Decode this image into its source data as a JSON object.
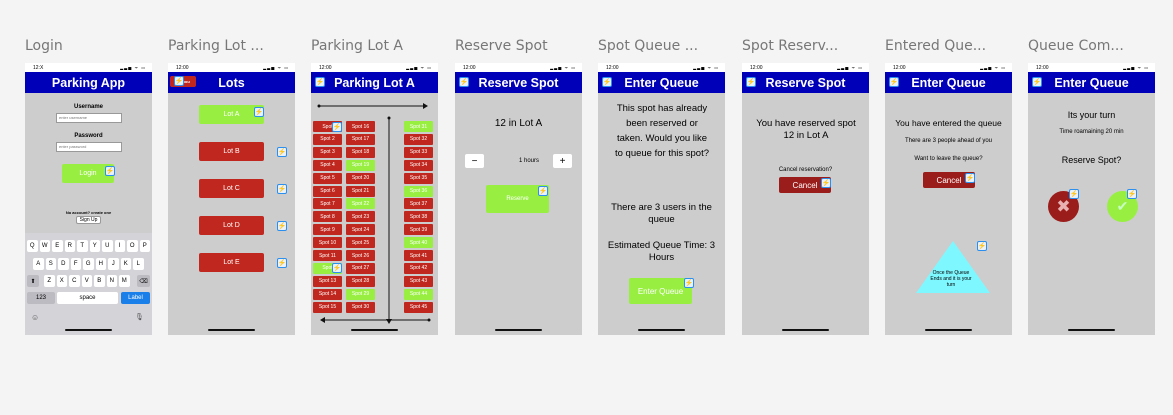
{
  "frames": [
    {
      "title": "Login"
    },
    {
      "title": "Parking Lot ..."
    },
    {
      "title": "Parking Lot A"
    },
    {
      "title": "Reserve Spot"
    },
    {
      "title": "Spot Queue ..."
    },
    {
      "title": "Spot Reserv..."
    },
    {
      "title": "Entered Que..."
    },
    {
      "title": "Queue Com..."
    }
  ],
  "status": {
    "time": "12:00",
    "time_login": "12:X",
    "signal": "▂▃▅ ᯤ ▭"
  },
  "icons": {
    "prototype": "lightning-icon"
  },
  "login": {
    "header": "Parking App",
    "username_label": "Username",
    "username_placeholder": "enter username",
    "password_label": "Password",
    "password_placeholder": "enter password",
    "login_button": "Login",
    "no_account": "No account? create one",
    "signup_button": "Sign Up",
    "keyboard": {
      "row1": [
        "Q",
        "W",
        "E",
        "R",
        "T",
        "Y",
        "U",
        "I",
        "O",
        "P"
      ],
      "row2": [
        "A",
        "S",
        "D",
        "F",
        "G",
        "H",
        "J",
        "K",
        "L"
      ],
      "row3": [
        "Z",
        "X",
        "C",
        "V",
        "B",
        "N",
        "M"
      ],
      "shift": "⬆",
      "backspace": "⌫",
      "num": "123",
      "space": "space",
      "enter": "Label",
      "emoji": "☺",
      "mic": "🎙"
    }
  },
  "lots": {
    "header": "Lots",
    "signout": "Signou",
    "items": [
      "Lot A",
      "Lot B",
      "Lot C",
      "Lot D",
      "Lot E"
    ]
  },
  "lotA": {
    "header": "Parking Lot A",
    "col1": [
      {
        "label": "Spot",
        "g": false
      },
      {
        "label": "Spot 2",
        "g": false
      },
      {
        "label": "Spot 3",
        "g": false
      },
      {
        "label": "Spot 4",
        "g": false
      },
      {
        "label": "Spot 5",
        "g": false
      },
      {
        "label": "Spot 6",
        "g": false
      },
      {
        "label": "Spot 7",
        "g": false
      },
      {
        "label": "Spot 8",
        "g": false
      },
      {
        "label": "Spot 9",
        "g": false
      },
      {
        "label": "Spot 10",
        "g": false
      },
      {
        "label": "Spot 11",
        "g": false
      },
      {
        "label": "Spot",
        "g": true
      },
      {
        "label": "Spot 13",
        "g": false
      },
      {
        "label": "Spot 14",
        "g": false
      },
      {
        "label": "Spot 15",
        "g": false
      }
    ],
    "col2": [
      {
        "label": "Spot 16",
        "g": false
      },
      {
        "label": "Spot 17",
        "g": false
      },
      {
        "label": "Spot 18",
        "g": false
      },
      {
        "label": "Spot 19",
        "g": true
      },
      {
        "label": "Spot 20",
        "g": false
      },
      {
        "label": "Spot 21",
        "g": false
      },
      {
        "label": "Spot 22",
        "g": true
      },
      {
        "label": "Spot 23",
        "g": false
      },
      {
        "label": "Spot 24",
        "g": false
      },
      {
        "label": "Spot 25",
        "g": false
      },
      {
        "label": "Spot 26",
        "g": false
      },
      {
        "label": "Spot 27",
        "g": false
      },
      {
        "label": "Spot 28",
        "g": false
      },
      {
        "label": "Spot 29",
        "g": true
      },
      {
        "label": "Spot 30",
        "g": false
      }
    ],
    "col3": [
      {
        "label": "Spot 31",
        "g": true
      },
      {
        "label": "Spot 32",
        "g": false
      },
      {
        "label": "Spot 33",
        "g": false
      },
      {
        "label": "Spot 34",
        "g": false
      },
      {
        "label": "Spot 35",
        "g": false
      },
      {
        "label": "Spot 36",
        "g": true
      },
      {
        "label": "Spot 37",
        "g": false
      },
      {
        "label": "Spot 38",
        "g": false
      },
      {
        "label": "Spot 39",
        "g": false
      },
      {
        "label": "Spot 40",
        "g": true
      },
      {
        "label": "Spot 41",
        "g": false
      },
      {
        "label": "Spot 42",
        "g": false
      },
      {
        "label": "Spot 43",
        "g": false
      },
      {
        "label": "Spot 44",
        "g": true
      },
      {
        "label": "Spot 45",
        "g": false
      }
    ]
  },
  "reserve": {
    "header": "Reserve Spot",
    "spot": "12 in Lot A",
    "minus": "−",
    "hours": "1 hours",
    "plus": "+",
    "button": "Reserve"
  },
  "spotqueue": {
    "header": "Enter Queue",
    "message": "This spot has already been reserved or taken. Would you like to queue for this spot?",
    "users": "There are 3 users in the queue",
    "estimate": "Estimated Queue Time: 3 Hours",
    "button": "Enter Queue"
  },
  "spotreserved": {
    "header": "Reserve Spot",
    "message": "You have reserved spot 12 in Lot A",
    "cancel_q": "Cancel reservation?",
    "cancel": "Cancel"
  },
  "entered": {
    "header": "Enter Queue",
    "message": "You have entered the queue",
    "ahead": "There are 3 people ahead of you",
    "leave": "Want to leave the queue?",
    "cancel": "Cancel",
    "triangle": "Once the Queue Ends and it is your turn"
  },
  "complete": {
    "header": "Enter Queue",
    "turn": "Its your turn",
    "time": "Time roamaining 20 min",
    "question": "Reserve Spot?",
    "decline": "✖",
    "accept": "✔"
  }
}
